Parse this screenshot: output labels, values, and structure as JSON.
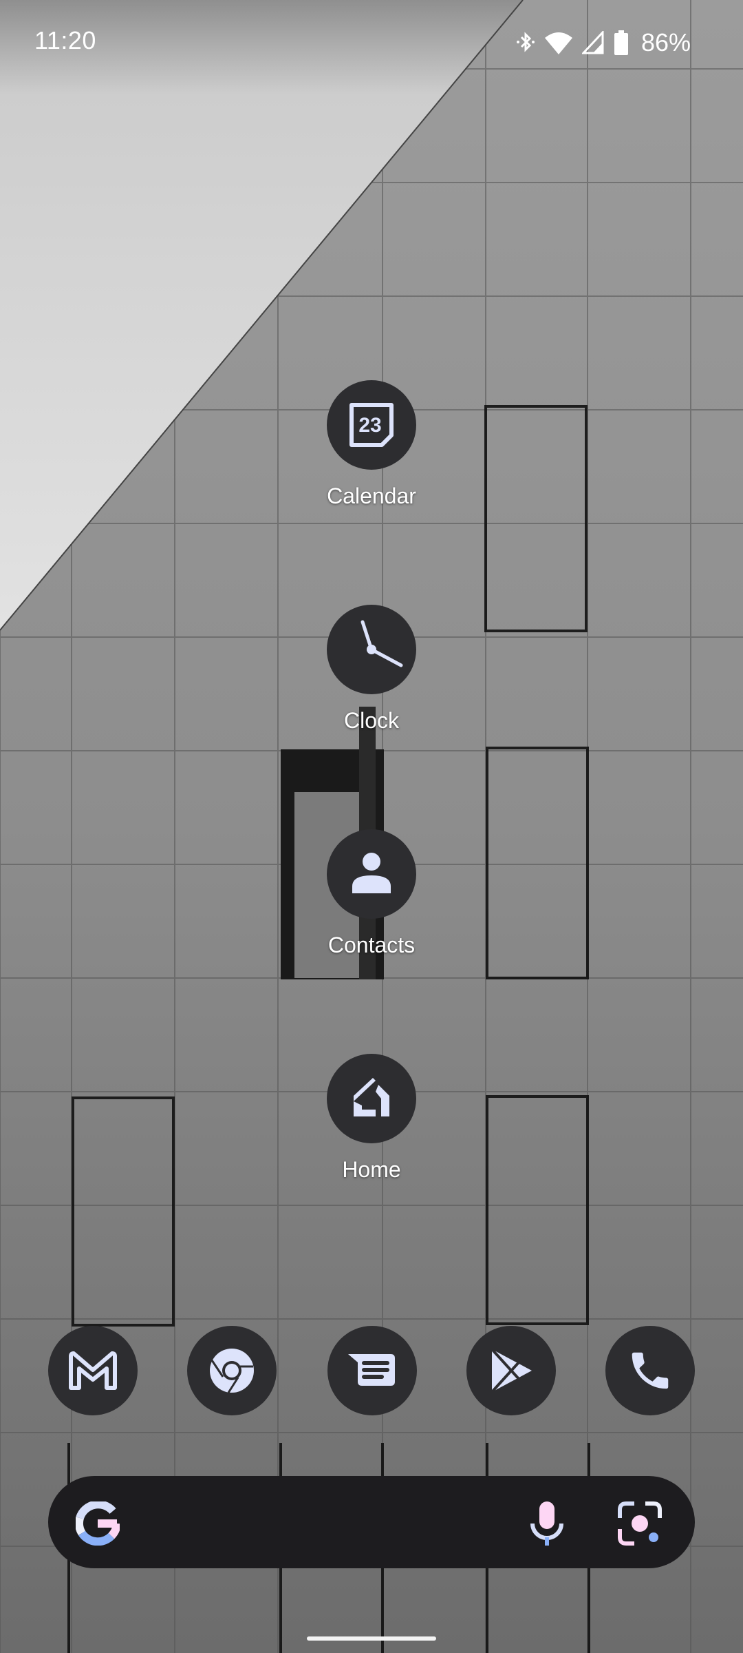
{
  "status_bar": {
    "time": "11:20",
    "icons": [
      "bluetooth-icon",
      "wifi-icon",
      "cellular-signal-icon",
      "battery-icon"
    ],
    "battery_percent": "86%"
  },
  "home_apps": [
    {
      "label": "Calendar",
      "icon": "calendar-icon",
      "icon_text": "23"
    },
    {
      "label": "Clock",
      "icon": "clock-icon"
    },
    {
      "label": "Contacts",
      "icon": "contacts-person-icon"
    },
    {
      "label": "Home",
      "icon": "google-home-icon"
    }
  ],
  "dock": [
    {
      "app": "Gmail",
      "icon": "gmail-icon"
    },
    {
      "app": "Chrome",
      "icon": "chrome-icon"
    },
    {
      "app": "Messages",
      "icon": "messages-icon"
    },
    {
      "app": "Play Store",
      "icon": "play-store-icon"
    },
    {
      "app": "Phone",
      "icon": "phone-icon"
    }
  ],
  "search_bar": {
    "logo": "google-g-icon",
    "mic": "microphone-icon",
    "lens": "google-lens-icon"
  },
  "colors": {
    "icon_bg": "#2d2d30",
    "icon_fg": "#dde3fb",
    "search_bg": "#1d1c1f",
    "accent_pink": "#fdd6f4",
    "accent_blue": "#8ab0f8",
    "accent_light": "#d6def9"
  }
}
